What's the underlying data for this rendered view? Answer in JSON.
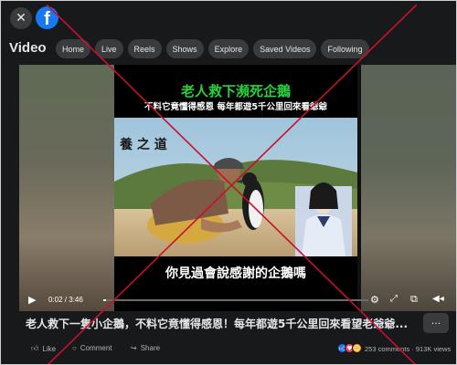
{
  "topbar": {
    "close_icon": "close-icon",
    "logo_letter": "f"
  },
  "nav": {
    "title": "Video",
    "tabs": [
      "Home",
      "Live",
      "Reels",
      "Shows",
      "Explore",
      "Saved Videos",
      "Following"
    ]
  },
  "video": {
    "headline": "老人救下瀕死企鵝",
    "subheadline": "不料它竟懂得感恩 每年都遊5千公里回來看爺爺",
    "watermark": "養之道",
    "caption": "你見過會說感謝的企鵝嗎",
    "time": "0:02 / 3:46",
    "progress": 0.01
  },
  "post": {
    "text": "老人救下一隻小企鵝，不料它竟懂得感恩！每年都遊5千公里回來看望老爺爺...",
    "more": "···"
  },
  "actions": {
    "like": "Like",
    "comment": "Comment",
    "share": "Share",
    "stats": "253 comments · 913K views"
  },
  "colors": {
    "background": "#18191a",
    "brand": "#1877f2",
    "green_title": "#27d23a",
    "red_cross": "#c8102e"
  }
}
